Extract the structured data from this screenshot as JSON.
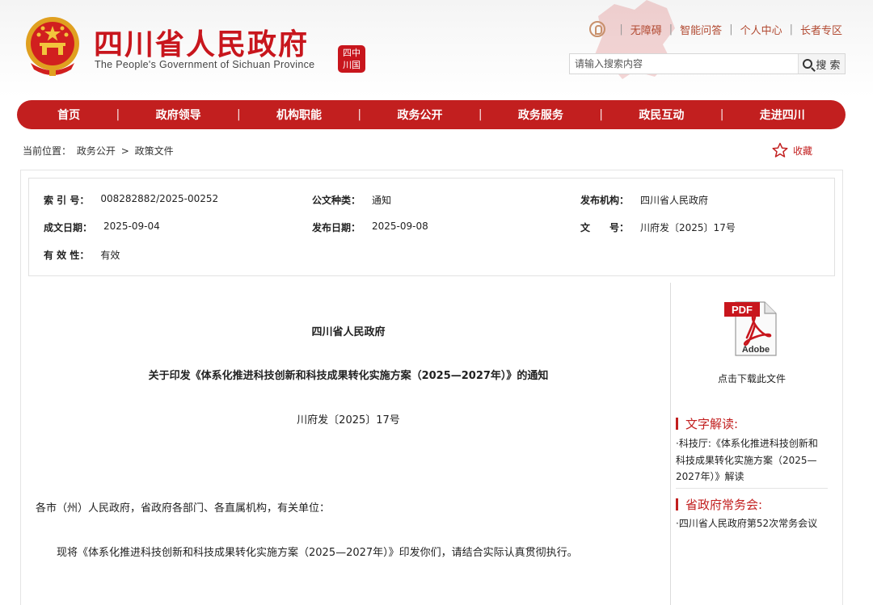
{
  "header": {
    "title": "四川省人民政府",
    "subtitle": "The People's Government of Sichuan Province",
    "seal_text": "中国四川",
    "links": [
      "无障碍",
      "智能问答",
      "个人中心",
      "长者专区"
    ],
    "search": {
      "placeholder": "请输入搜索内容",
      "button_label": "搜 索"
    },
    "accent_color": "#c21f1f"
  },
  "nav": {
    "items": [
      "首页",
      "政府领导",
      "机构职能",
      "政务公开",
      "政务服务",
      "政民互动",
      "走进四川"
    ],
    "separator": "|"
  },
  "breadcrumb": {
    "label": "当前位置：",
    "items": [
      "政务公开",
      "政策文件"
    ],
    "separator": ">"
  },
  "favorite": {
    "label": "收藏",
    "icon": "star-icon"
  },
  "meta": {
    "index_no": {
      "key": "索 引 号：",
      "value": "008282882/2025-00252"
    },
    "doc_type": {
      "key": "公文种类：",
      "value": "通知"
    },
    "issuer": {
      "key": "发布机构：",
      "value": "四川省人民政府"
    },
    "written_date": {
      "key": "成文日期：",
      "value": "2025-09-04"
    },
    "publish_date": {
      "key": "发布日期：",
      "value": "2025-09-08"
    },
    "doc_no": {
      "key": "文　　号：",
      "value": "川府发〔2025〕17号"
    },
    "validity": {
      "key": "有 效 性：",
      "value": "有效"
    }
  },
  "article": {
    "issuer": "四川省人民政府",
    "title": "关于印发《体系化推进科技创新和科技成果转化实施方案（2025—2027年）》的通知",
    "doc_no": "川府发〔2025〕17号",
    "addressee": "各市（州）人民政府，省政府各部门、各直属机构，有关单位：",
    "paragraph": "现将《体系化推进科技创新和科技成果转化实施方案（2025—2027年）》印发你们，请结合实际认真贯彻执行。"
  },
  "sidebar": {
    "pdf_icon": "pdf-icon",
    "pdf_badge": "PDF",
    "pdf_brand": "Adobe",
    "download_label": "点击下载此文件",
    "section1_title": "文字解读:",
    "section1_link": "·科技厅:《体系化推进科技创新和科技成果转化实施方案（2025—2027年）》解读",
    "section1_lines": [
      "·科技厅:《体系化推进科技创新和",
      "科技成果转化实施方案（2025—",
      "2027年）》解读"
    ],
    "section2_title": "省政府常务会:",
    "section2_link": "·四川省人民政府第52次常务会议"
  }
}
